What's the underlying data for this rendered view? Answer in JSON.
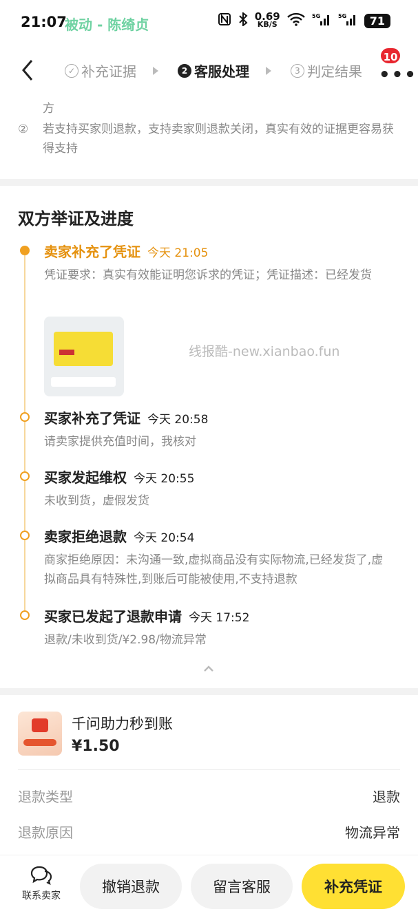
{
  "status_bar": {
    "time": "21:07",
    "tag": "被动 - 陈绮贞",
    "speed_value": "0.69",
    "speed_unit": "KB/S",
    "battery": "71"
  },
  "nav": {
    "steps": [
      {
        "num": "✓",
        "label": "补充证据"
      },
      {
        "num": "2",
        "label": "客服处理"
      },
      {
        "num": "3",
        "label": "判定结果"
      }
    ],
    "more_badge": "10"
  },
  "tips": {
    "item1": {
      "idx": "",
      "text": "方"
    },
    "item2": {
      "idx": "②",
      "text": "若支持买家则退款，支持卖家则退款关闭，真实有效的证据更容易获得支持"
    }
  },
  "progress": {
    "title": "双方举证及进度",
    "events": [
      {
        "title": "卖家补充了凭证",
        "time": "今天 21:05",
        "desc": "凭证要求：真实有效能证明您诉求的凭证；凭证描述：已经发货"
      },
      {
        "title": "买家补充了凭证",
        "time": "今天 20:58",
        "desc": "请卖家提供充值时间，我核对"
      },
      {
        "title": "买家发起维权",
        "time": "今天 20:55",
        "desc": "未收到货，虚假发货"
      },
      {
        "title": "卖家拒绝退款",
        "time": "今天 20:54",
        "desc": "商家拒绝原因：未沟通一致,虚拟商品没有实际物流,已经发货了,虚拟商品具有特殊性,到账后可能被使用,不支持退款"
      },
      {
        "title": "买家已发起了退款申请",
        "time": "今天 17:52",
        "desc": "退款/未收到货/¥2.98/物流异常"
      }
    ],
    "watermark": "线报酷-new.xianbao.fun"
  },
  "product": {
    "name": "千问助力秒到账",
    "price": "¥1.50",
    "refund_type_label": "退款类型",
    "refund_type_value": "退款",
    "refund_reason_label": "退款原因",
    "refund_reason_value": "物流异常"
  },
  "bottom_bar": {
    "contact_label": "联系卖家",
    "cancel_label": "撤销退款",
    "message_label": "留言客服",
    "supplement_label": "补充凭证"
  },
  "colors": {
    "accent_orange": "#e59210",
    "button_yellow": "#ffe033",
    "badge_red": "#e8262f"
  }
}
